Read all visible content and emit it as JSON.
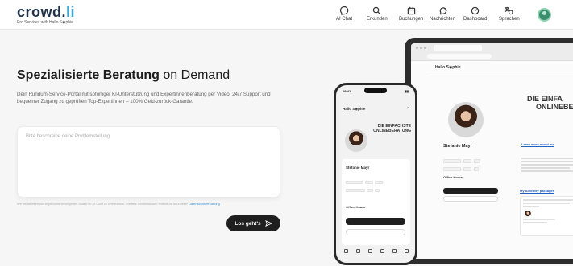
{
  "logo": {
    "text_main": "crowd.",
    "text_accent": "li",
    "subtitle": "Pro Services with Hallo S◉phie"
  },
  "nav": [
    {
      "label": "AI Chat",
      "icon": "chat-icon"
    },
    {
      "label": "Erkunden",
      "icon": "search-icon"
    },
    {
      "label": "Buchungen",
      "icon": "calendar-icon"
    },
    {
      "label": "Nachrichten",
      "icon": "messages-icon"
    },
    {
      "label": "Dashboard",
      "icon": "dashboard-icon"
    },
    {
      "label": "Sprachen",
      "icon": "language-icon"
    }
  ],
  "hero": {
    "title_bold": "Spezialisierte Beratung",
    "title_light": " on Demand",
    "description": "Dein Rundum-Service-Portal mit sofortiger KI-Unterstützung und Expertinnenberatung per Video. 24/7 Support und bequemer Zugang zu geprüften Top-Expertinnen – 100% Geld-zurück-Garantie."
  },
  "problem_input": {
    "placeholder": "Bitte beschreibe deine Problemstellung",
    "value": ""
  },
  "privacy": {
    "text": "Wir verarbeiten keine personenbezogenen Daten im AI Chat zu übermitteln. Weitere Informationen findest du in unserer",
    "link": "Datenschutzerklärung"
  },
  "cta": {
    "label": "Los geht's"
  },
  "mockup": {
    "brand": "Hallo S◉phie",
    "headline_line1": "DIE EINFACHSTE",
    "headline_line2": "ONLINEBERATUNG",
    "laptop_headline_line1": "DIE EINFA",
    "laptop_headline_line2": "ONLINEBE",
    "expert_name": "Stefanie Mayr",
    "office_hours": "Office Hours",
    "learn_more": "Learn more about me",
    "advisory": "My Advisory packages",
    "status_time": "09:41"
  },
  "colors": {
    "accent": "#3fa6d9",
    "cta_bg": "#1f1f1f",
    "avatar": "#3c8f6e"
  }
}
